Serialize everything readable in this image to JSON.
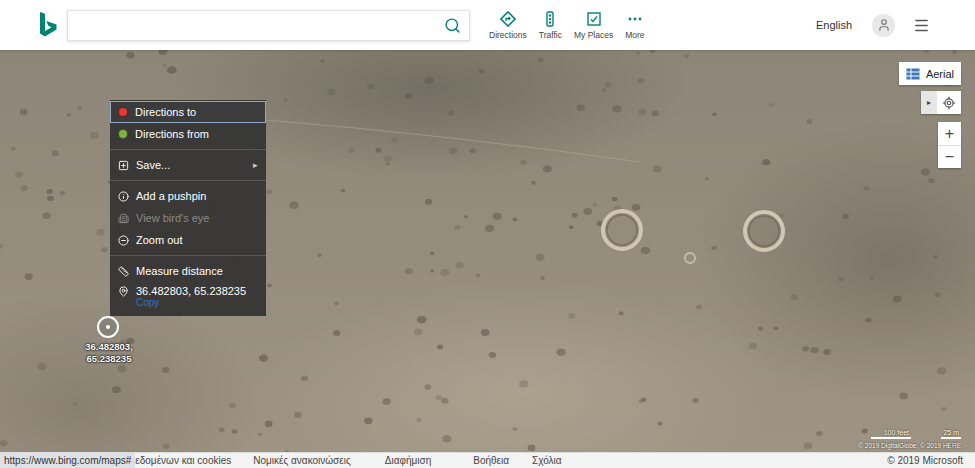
{
  "header": {
    "search": {
      "value": ""
    },
    "nav": [
      {
        "label": "Directions"
      },
      {
        "label": "Traffic"
      },
      {
        "label": "My Places"
      },
      {
        "label": "More"
      }
    ],
    "language": "English"
  },
  "context_menu": {
    "items": [
      {
        "kind": "dot",
        "label": "Directions to",
        "color": "#e53935",
        "selected": true,
        "disabled": false
      },
      {
        "kind": "dot",
        "label": "Directions from",
        "color": "#7cb342",
        "selected": false,
        "disabled": false
      },
      {
        "kind": "separator"
      },
      {
        "kind": "submenu",
        "label": "Save...",
        "arrow": "▸",
        "selected": false,
        "disabled": false
      },
      {
        "kind": "separator"
      },
      {
        "kind": "info",
        "label": "Add a pushpin",
        "selected": false,
        "disabled": false
      },
      {
        "kind": "birdseye",
        "label": "View bird's eye",
        "selected": false,
        "disabled": true
      },
      {
        "kind": "zoom",
        "label": "Zoom out",
        "selected": false,
        "disabled": false
      },
      {
        "kind": "separator"
      },
      {
        "kind": "measure",
        "label": "Measure distance",
        "selected": false,
        "disabled": false
      },
      {
        "kind": "location",
        "label": "36.482803, 65.238235",
        "link": "Copy",
        "selected": false,
        "disabled": false
      }
    ]
  },
  "map": {
    "view_button": "Aerial",
    "panel_toggle": "▸",
    "zoom": [
      "+",
      "−"
    ],
    "pin": {
      "label_lines": [
        "36.482803,",
        "65.238235"
      ]
    },
    "scale": [
      "100 feet",
      "25 m"
    ],
    "attribution": "© 2019 DigitalGlobe, © 2019 HERE"
  },
  "footer": {
    "status_url": "https://www.bing.com/maps#",
    "links": [
      "εδομένων και cookies",
      "Νομικές ανακοινώσεις",
      "Διαφήμιση",
      "Βοήθεια",
      "Σχόλια"
    ],
    "copyright": "© 2019 Microsoft"
  }
}
